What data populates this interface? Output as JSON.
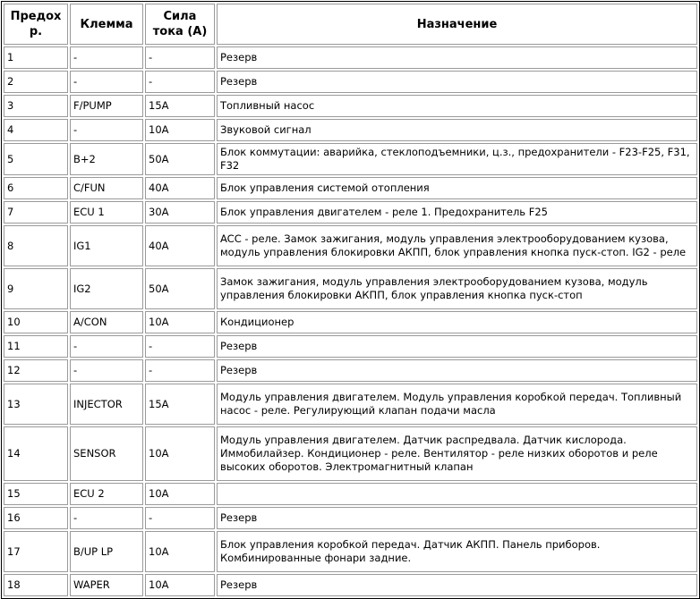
{
  "table": {
    "headers": [
      {
        "label": "Предохр."
      },
      {
        "label": "Клемма"
      },
      {
        "label": "Сила тока (A)"
      },
      {
        "label": "Назначение"
      }
    ],
    "rows": [
      {
        "fuse": "1",
        "terminal": "-",
        "amperage": "-",
        "purpose": "Резерв",
        "lines": 1
      },
      {
        "fuse": "2",
        "terminal": "-",
        "amperage": "-",
        "purpose": "Резерв",
        "lines": 1
      },
      {
        "fuse": "3",
        "terminal": "F/PUMP",
        "amperage": "15A",
        "purpose": "Топливный насос",
        "lines": 1
      },
      {
        "fuse": "4",
        "terminal": "-",
        "amperage": "10A",
        "purpose": "Звуковой сигнал",
        "lines": 1
      },
      {
        "fuse": "5",
        "terminal": "B+2",
        "amperage": "50A",
        "purpose": "Блок коммутации: аварийка, стеклоподъемники, ц.з., предохранители - F23-F25, F31, F32",
        "lines": 1
      },
      {
        "fuse": "6",
        "terminal": "C/FUN",
        "amperage": "40A",
        "purpose": "Блок управления системой отопления",
        "lines": 1
      },
      {
        "fuse": "7",
        "terminal": "ECU 1",
        "amperage": "30A",
        "purpose": "Блок управления двигателем - реле 1. Предохранитель F25",
        "lines": 1
      },
      {
        "fuse": "8",
        "terminal": "IG1",
        "amperage": "40A",
        "purpose": "ACC - реле. Замок зажигания, модуль управления электрооборудованием кузова, модуль управления блокировки АКПП, блок управления кнопка пуск-стоп. IG2 - реле",
        "lines": 2
      },
      {
        "fuse": "9",
        "terminal": "IG2",
        "amperage": "50A",
        "purpose": "Замок зажигания, модуль управления электрооборудованием кузова, модуль управления блокировки АКПП, блок управления кнопка пуск-стоп",
        "lines": 2
      },
      {
        "fuse": "10",
        "terminal": "A/CON",
        "amperage": "10A",
        "purpose": "Кондиционер",
        "lines": 1
      },
      {
        "fuse": "11",
        "terminal": "-",
        "amperage": "-",
        "purpose": "Резерв",
        "lines": 1
      },
      {
        "fuse": "12",
        "terminal": "-",
        "amperage": "-",
        "purpose": "Резерв",
        "lines": 1
      },
      {
        "fuse": "13",
        "terminal": "INJECTOR",
        "amperage": "15A",
        "purpose": "Модуль управления двигателем. Модуль управления коробкой передач. Топливный насос - реле. Регулирующий клапан подачи масла",
        "lines": 2
      },
      {
        "fuse": "14",
        "terminal": "SENSOR",
        "amperage": "10A",
        "purpose": "Модуль управления двигателем. Датчик распредвала. Датчик кислорода. Иммобилайзер. Кондиционер - реле. Вентилятор - реле низких оборотов и реле высоких оборотов. Электромагнитный клапан",
        "lines": 3
      },
      {
        "fuse": "15",
        "terminal": "ECU 2",
        "amperage": "10A",
        "purpose": "",
        "lines": 1
      },
      {
        "fuse": "16",
        "terminal": "-",
        "amperage": "-",
        "purpose": "Резерв",
        "lines": 1
      },
      {
        "fuse": "17",
        "terminal": "B/UP LP",
        "amperage": "10A",
        "purpose": "Блок управления коробкой передач. Датчик АКПП. Панель приборов. Комбинированные фонари задние.",
        "lines": 2
      },
      {
        "fuse": "18",
        "terminal": "WAPER",
        "amperage": "10A",
        "purpose": "Резерв",
        "lines": 1
      }
    ]
  },
  "colors": {
    "outer_border": "#000000",
    "cell_border": "#9a9a9a",
    "text": "#000000",
    "background": "#ffffff"
  }
}
